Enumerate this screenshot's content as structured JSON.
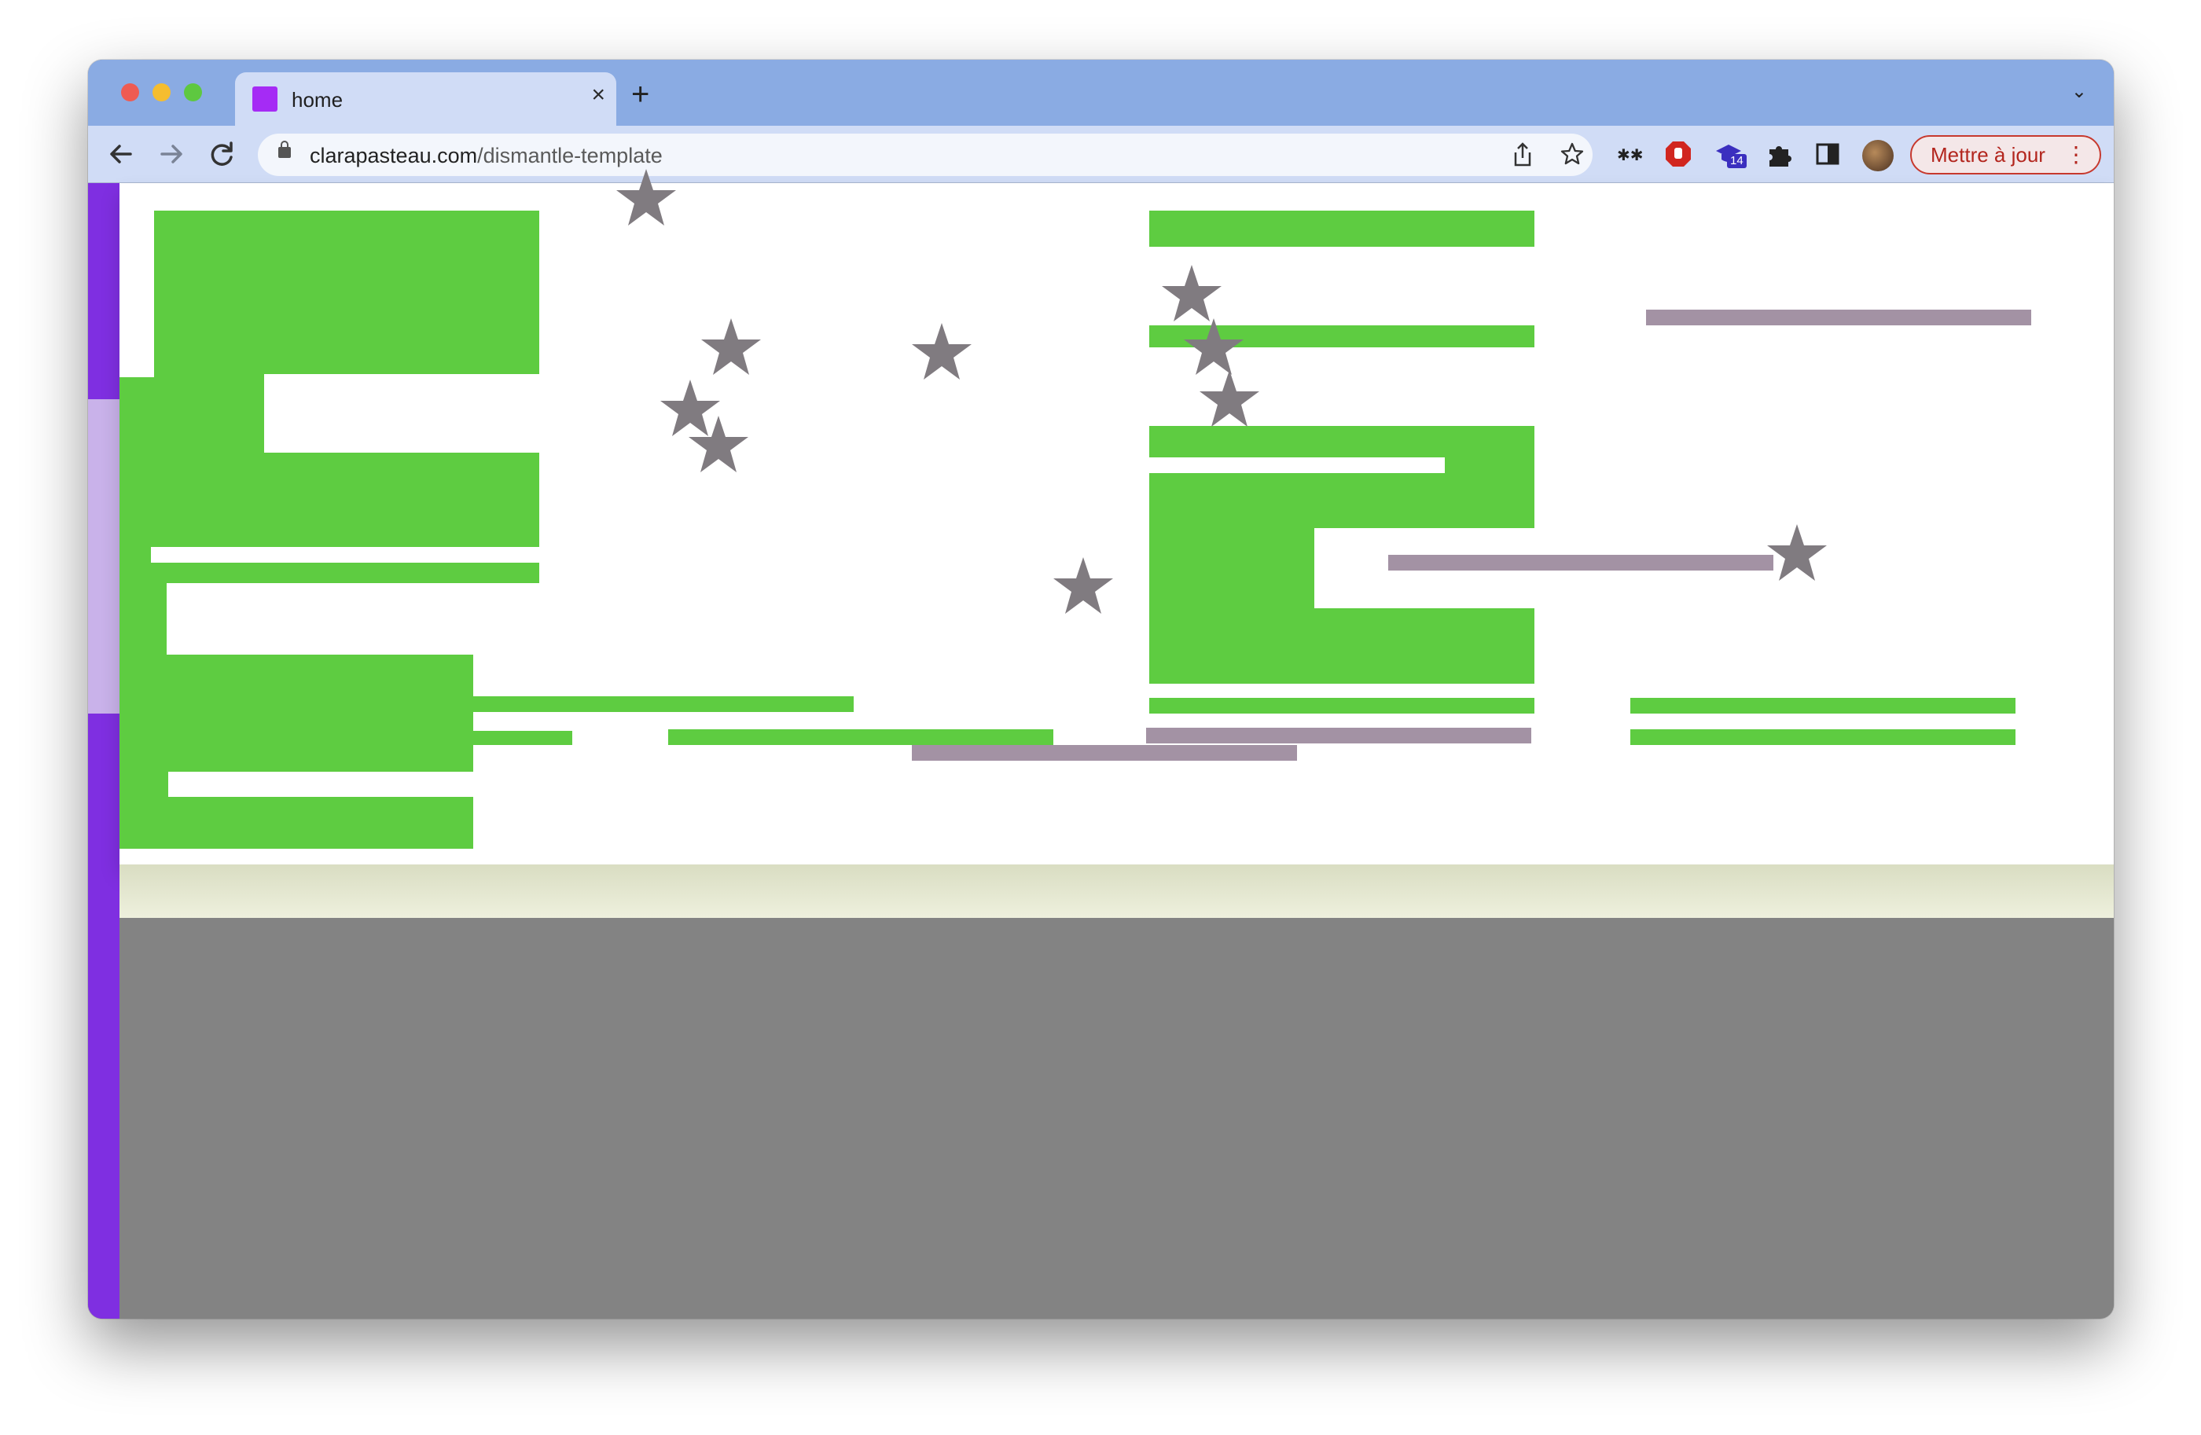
{
  "browser": {
    "tab_title": "home",
    "new_tab_symbol": "+",
    "close_tab_symbol": "×",
    "tab_list_symbol": "⌄",
    "url_domain": "clarapasteau.com",
    "url_path": "/dismantle-template",
    "update_button": "Mettre à jour",
    "extension_badge": "14",
    "icons": [
      "back-icon",
      "forward-icon",
      "reload-icon",
      "lock-icon",
      "share-icon",
      "bookmark-star-icon",
      "eyes-extension-icon",
      "adblock-extension-icon",
      "graduation-cap-extension-icon",
      "puzzle-extensions-icon",
      "side-panel-icon",
      "profile-avatar",
      "more-menu-icon"
    ],
    "colors": {
      "tab_strip": "#8aabe3",
      "toolbar": "#d0dcf6",
      "favicon": "#a52bf5",
      "update_accent": "#c7392e"
    }
  },
  "page": {
    "colors": {
      "green": "#5ecc41",
      "mauve": "#a392a4",
      "star": "#807b80",
      "purple_bar": "#7f2fe1",
      "lilac_bar": "#c9b2ea",
      "cream_band": "#eef0dd",
      "background": "#838383"
    },
    "star_count": 11
  }
}
